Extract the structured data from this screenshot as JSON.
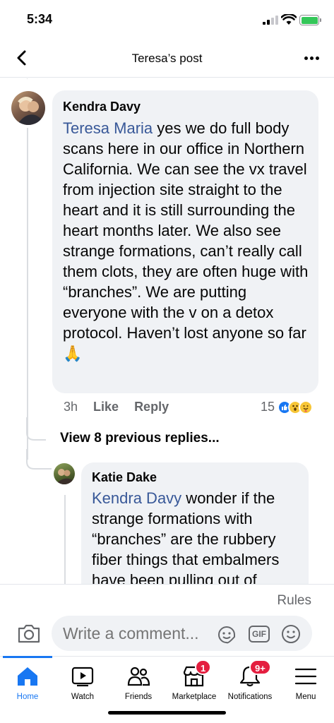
{
  "status_bar": {
    "time": "5:34"
  },
  "header": {
    "title": "Teresa’s post"
  },
  "comments": [
    {
      "author": "Kendra Davy",
      "mention": "Teresa Maria",
      "text": " yes we do full body scans here in our office in Northern California.  We can see the  vx travel from injection site straight to the heart and it is still surrounding the heart months later.  We also see strange formations, can’t really call them clots,  they are often huge with “branches”.  We are putting everyone with the v on a detox protocol.  Haven’t lost anyone so far",
      "emoji": "🙏",
      "time": "3h",
      "like_label": "Like",
      "reply_label": "Reply",
      "reaction_count": "15"
    },
    {
      "author": "Katie Dake",
      "mention": "Kendra Davy",
      "text": " wonder if the strange formations with “branches” are the rubbery fiber things that embalmers have been pulling out of"
    }
  ],
  "view_previous_replies": "View 8 previous replies...",
  "rules_label": "Rules",
  "composer": {
    "placeholder": "Write a comment...",
    "gif_label": "GIF"
  },
  "tabs": [
    {
      "label": "Home",
      "icon": "home-icon"
    },
    {
      "label": "Watch",
      "icon": "watch-icon"
    },
    {
      "label": "Friends",
      "icon": "friends-icon"
    },
    {
      "label": "Marketplace",
      "icon": "marketplace-icon",
      "badge": "1"
    },
    {
      "label": "Notifications",
      "icon": "bell-icon",
      "badge": "9+"
    },
    {
      "label": "Menu",
      "icon": "menu-icon"
    }
  ],
  "colors": {
    "accent": "#1877f2",
    "mention": "#385898",
    "badge": "#e41e3f",
    "bubble": "#f0f2f5"
  }
}
